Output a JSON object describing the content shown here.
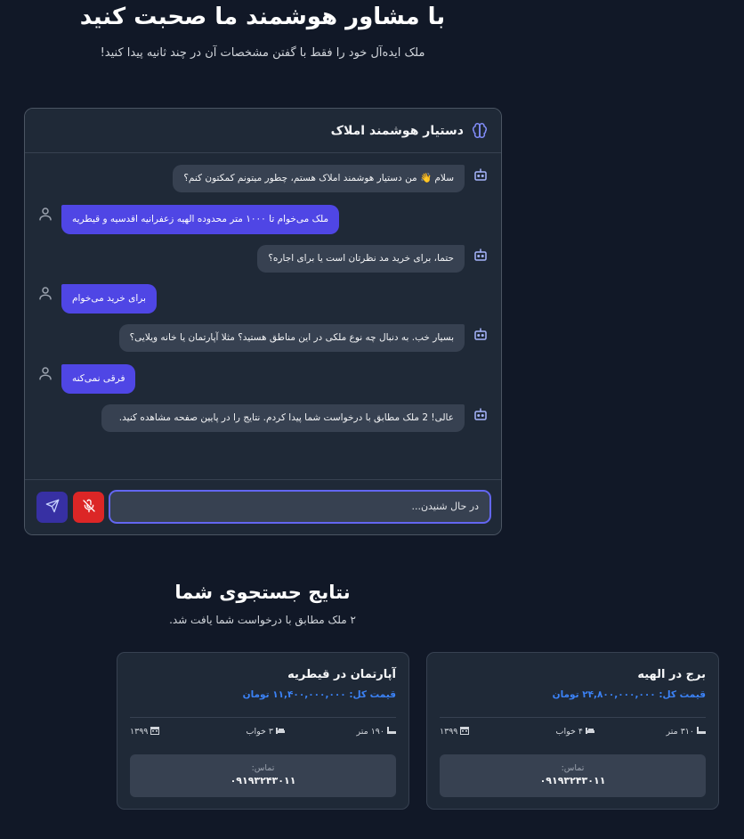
{
  "hero": {
    "title": "با مشاور هوشمند ما صحبت کنید",
    "subtitle": "ملک ایده‌آل خود را فقط با گفتن مشخصات آن در چند ثانیه پیدا کنید!"
  },
  "chat": {
    "header_title": "دستیار هوشمند املاک",
    "messages": [
      {
        "sender": "bot",
        "text": "سلام 👋 من دستیار هوشمند املاک هستم، چطور میتونم کمکتون کنم؟"
      },
      {
        "sender": "user",
        "text": "ملک می‌خوام تا ۱۰۰۰ متر محدوده الهیه زعفرانیه اقدسیه و قیطریه"
      },
      {
        "sender": "bot",
        "text": "حتما، برای خرید مد نظرتان است یا برای اجاره؟"
      },
      {
        "sender": "user",
        "text": "برای خرید می‌خوام"
      },
      {
        "sender": "bot",
        "text": "بسیار خب. به دنبال چه نوع ملکی در این مناطق هستید؟ مثلا آپارتمان یا خانه ویلایی؟"
      },
      {
        "sender": "user",
        "text": "فرقی نمی‌کنه"
      },
      {
        "sender": "bot",
        "text": "عالی! 2 ملک مطابق با درخواست شما پیدا کردم. نتایج را در پایین صفحه مشاهده کنید."
      }
    ],
    "input_placeholder": "در حال شنیدن..."
  },
  "results": {
    "title": "نتایج جستجوی شما",
    "subtitle": "۲ ملک مطابق با درخواست شما یافت شد.",
    "cards": [
      {
        "title": "برج در الهیه",
        "price": "قیمت کل: ۲۴,۸۰۰,۰۰۰,۰۰۰ تومان",
        "area": "۳۱۰ متر",
        "beds": "۴ خواب",
        "year": "۱۳۹۹",
        "contact_label": "تماس:",
        "phone": "۰۹۱۹۳۲۴۳۰۱۱"
      },
      {
        "title": "آپارتمان در قیطریه",
        "price": "قیمت کل: ۱۱,۴۰۰,۰۰۰,۰۰۰ تومان",
        "area": "۱۹۰ متر",
        "beds": "۳ خواب",
        "year": "۱۳۹۹",
        "contact_label": "تماس:",
        "phone": "۰۹۱۹۳۲۴۳۰۱۱"
      }
    ]
  },
  "colors": {
    "background": "#111827",
    "panel": "#1f2937",
    "user_bubble": "#4f46e5",
    "bot_bubble": "#374151",
    "mic_active": "#dc2626",
    "price": "#3b82f6"
  },
  "icons": [
    "brain-icon",
    "bot-icon",
    "user-icon",
    "mic-off-icon",
    "send-icon",
    "area-icon",
    "bed-icon",
    "calendar-icon"
  ]
}
